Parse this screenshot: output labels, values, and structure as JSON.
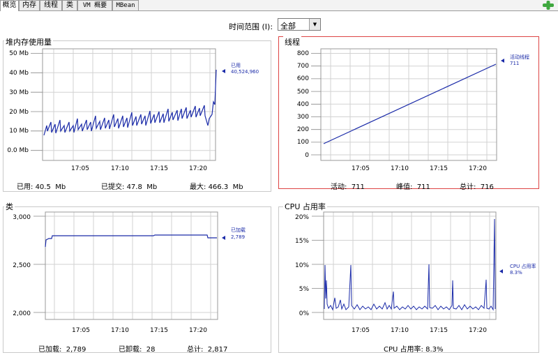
{
  "tabs": [
    "概览",
    "内存",
    "线程",
    "类",
    "VM 概要",
    "MBean"
  ],
  "time_range": {
    "label": "时间范围 (I):",
    "value": "全部"
  },
  "colors": {
    "line": "#1a2aa8",
    "grid": "#d2d2d2",
    "selected_border": "#dd4444"
  },
  "panels": {
    "heap": {
      "title": "堆内存使用量",
      "legend_label": "已用",
      "legend_value": "40,524,960",
      "footer": [
        {
          "label": "已用:",
          "value": "40.5",
          "unit": "Mb"
        },
        {
          "label": "已提交:",
          "value": "47.8",
          "unit": "Mb"
        },
        {
          "label": "最大:",
          "value": "466.3",
          "unit": "Mb"
        }
      ]
    },
    "threads": {
      "title": "线程",
      "legend_label": "活动线程",
      "legend_value": "711",
      "footer": [
        {
          "label": "活动:",
          "value": "711"
        },
        {
          "label": "峰值:",
          "value": "711"
        },
        {
          "label": "总计:",
          "value": "716"
        }
      ]
    },
    "classes": {
      "title": "类",
      "legend_label": "已加载",
      "legend_value": "2,789",
      "footer": [
        {
          "label": "已加载:",
          "value": "2,789"
        },
        {
          "label": "已卸载:",
          "value": "28"
        },
        {
          "label": "总计:",
          "value": "2,817"
        }
      ]
    },
    "cpu": {
      "title": "CPU 占用率",
      "legend_label": "CPU 占用率",
      "legend_value": "8.3%",
      "footer": [
        {
          "label": "CPU 占用率:",
          "value": "8.3%"
        }
      ]
    }
  },
  "chart_data": [
    {
      "type": "line",
      "title": "堆内存使用量",
      "x_ticks": [
        "17:05",
        "17:10",
        "17:15",
        "17:20"
      ],
      "y_ticks": [
        "0.0 Mb",
        "10 Mb",
        "20 Mb",
        "30 Mb",
        "40 Mb",
        "50 Mb"
      ],
      "ylim": [
        0,
        50
      ],
      "grid": true,
      "series": [
        {
          "name": "已用",
          "x": [
            17.04,
            17.05,
            17.08,
            17.09,
            17.12,
            17.13,
            17.16,
            17.17,
            17.2,
            17.21,
            17.24,
            17.25
          ],
          "y": [
            8,
            14,
            8,
            15,
            9,
            16,
            10,
            17,
            11,
            19,
            14,
            40.5
          ]
        }
      ]
    },
    {
      "type": "line",
      "title": "线程",
      "x_ticks": [
        "17:05",
        "17:10",
        "17:15",
        "17:20"
      ],
      "y_ticks": [
        "0",
        "100",
        "200",
        "300",
        "400",
        "500",
        "600",
        "700",
        "800"
      ],
      "ylim": [
        0,
        800
      ],
      "grid": true,
      "series": [
        {
          "name": "活动线程",
          "x": [
            0,
            1
          ],
          "y": [
            50,
            711
          ]
        }
      ]
    },
    {
      "type": "line",
      "title": "类",
      "x_ticks": [
        "17:05",
        "17:10",
        "17:15",
        "17:20"
      ],
      "y_ticks": [
        "2,000",
        "2,500",
        "3,000"
      ],
      "ylim": [
        2000,
        3000
      ],
      "grid": true,
      "series": [
        {
          "name": "已加载",
          "x": [
            0,
            0.02,
            0.05,
            1
          ],
          "y": [
            2700,
            2760,
            2800,
            2789
          ]
        }
      ]
    },
    {
      "type": "line",
      "title": "CPU 占用率",
      "x_ticks": [
        "17:05",
        "17:10",
        "17:15",
        "17:20"
      ],
      "y_ticks": [
        "0%",
        "5%",
        "10%",
        "15%",
        "20%"
      ],
      "ylim": [
        0,
        20
      ],
      "grid": true,
      "series": [
        {
          "name": "CPU 占用率",
          "x": [
            0,
            0.2,
            0.5,
            0.8,
            1
          ],
          "y": [
            10,
            10,
            8,
            7,
            19.5
          ]
        }
      ]
    }
  ]
}
